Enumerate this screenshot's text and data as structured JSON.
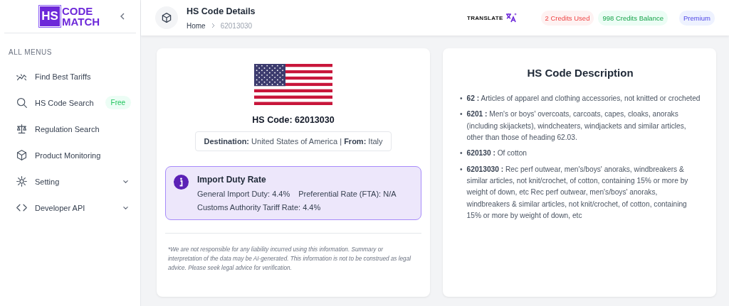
{
  "logo": {
    "mark": "HS",
    "line_1": "CODE",
    "line_2": "MATCH"
  },
  "sidebar": {
    "section_title": "ALL MENUS",
    "items": [
      {
        "label": "Find Best Tariffs"
      },
      {
        "label": "HS Code Search",
        "badge": "Free"
      },
      {
        "label": "Regulation Search"
      },
      {
        "label": "Product Monitoring"
      },
      {
        "label": "Setting",
        "expanded": false
      },
      {
        "label": "Developer API",
        "expanded": false
      }
    ]
  },
  "header": {
    "title": "HS Code Details",
    "breadcrumb": [
      "Home",
      "62013030"
    ],
    "translate": "TRANSLATE",
    "pills": [
      {
        "label": "2 Credits Used"
      },
      {
        "label": "998 Credits Balance"
      },
      {
        "label": "Premium"
      }
    ]
  },
  "details": {
    "hs_code": "HS Code: 62013030",
    "route": "**Destination:** United States of America | **From:** Italy",
    "duty": {
      "title": "Import Duty Rate",
      "general": "General Import Duty: 4.4%",
      "preferential": "Preferential Rate (FTA): N/A",
      "customs": "Customs Authority Tariff Rate: 4.4%"
    },
    "disclaimer": "*We are not responsible for any liability incurred using this information. Summary or interpretation of the data may be AI-generated. This information is not to be construed as legal advice. Please seek legal advice for verification."
  },
  "description": {
    "title": "HS Code Description",
    "items": [
      {
        "bullet": "•",
        "text": "**62 :** Articles of apparel and clothing accessories, not knitted or crocheted"
      },
      {
        "bullet": "•",
        "text": "**6201 :** Men's or boys' overcoats, carcoats, capes, cloaks, anoraks (including skijackets), windcheaters, windjackets and similar articles, other than those of heading 62.03."
      },
      {
        "bullet": "•",
        "text": "**620130 :** Of cotton"
      },
      {
        "bullet": "•",
        "text": "**62013030 :** Rec perf outwear, men's/boys' anoraks, windbreakers & similar articles, not knit/crochet, of cotton, containing 15% or more by weight of down, etc Rec perf outwear, men's/boys' anoraks, windbreakers & similar articles, not knit/crochet, of cotton, containing 15% or more by weight of down, etc"
      }
    ]
  }
}
